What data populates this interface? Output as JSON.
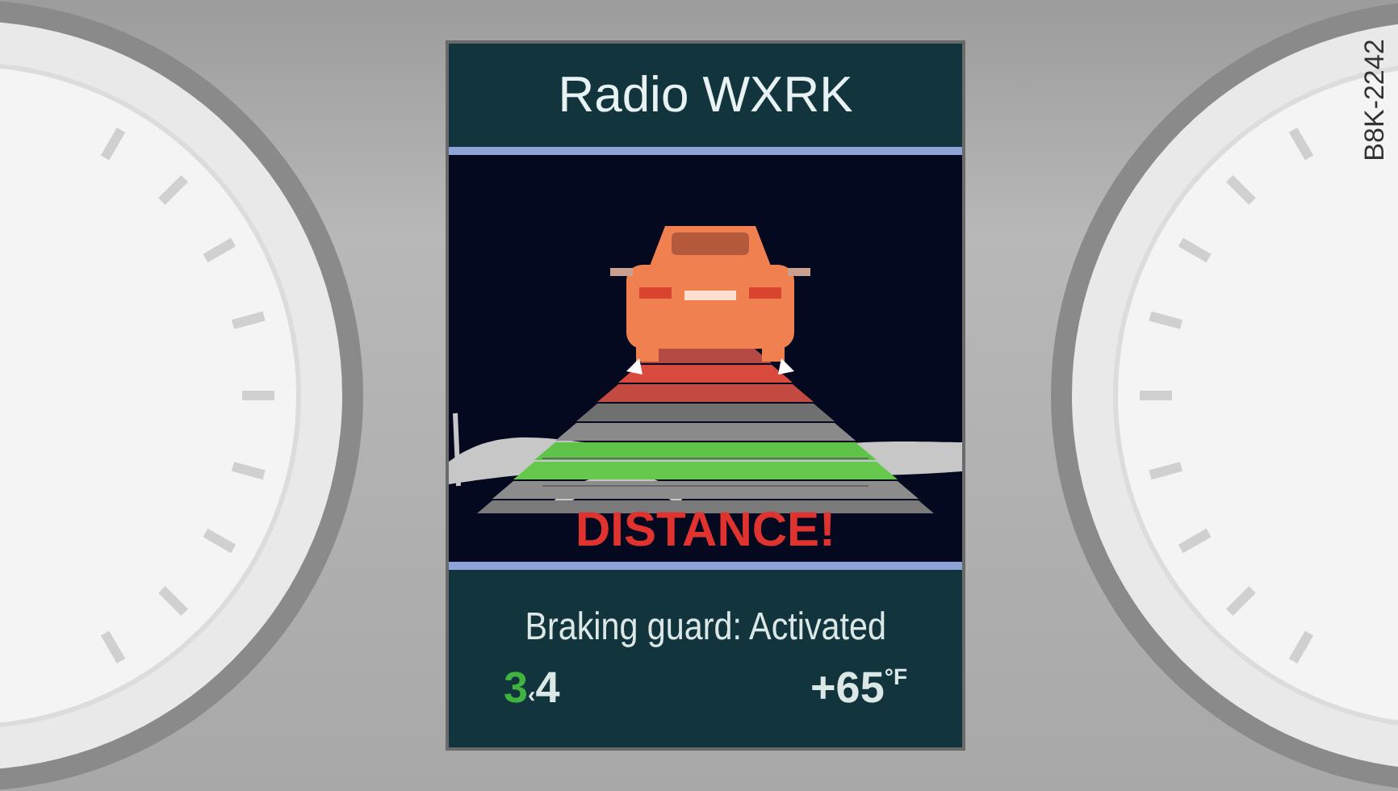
{
  "display": {
    "title": "Radio WXRK",
    "warning": "DISTANCE!",
    "message": "Braking guard: Activated",
    "gear": {
      "current": "3",
      "arrow": "‹",
      "recommended": "4"
    },
    "temperature": {
      "value": "+65",
      "unit": "°F"
    }
  },
  "figure_label": "B8K-2242"
}
